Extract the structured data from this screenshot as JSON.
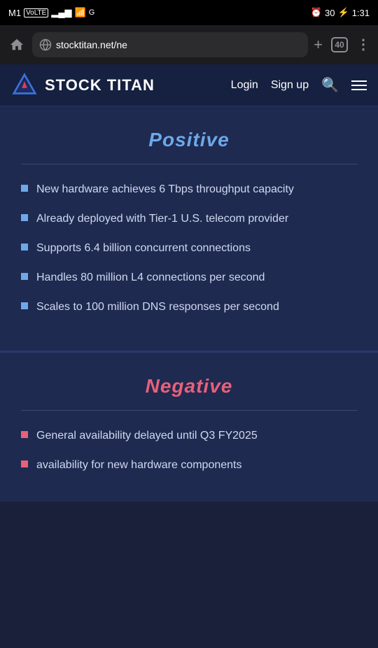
{
  "statusBar": {
    "carrier": "M1",
    "network": "VoLTE",
    "time": "1:31",
    "battery": "30",
    "tabsCount": "40"
  },
  "addressBar": {
    "url": "stocktitan.net/ne"
  },
  "navbar": {
    "title": "STOCK TITAN",
    "loginLabel": "Login",
    "signupLabel": "Sign up"
  },
  "positive": {
    "title": "Positive",
    "items": [
      "New hardware achieves 6 Tbps throughput capacity",
      "Already deployed with Tier-1 U.S. telecom provider",
      "Supports 6.4 billion concurrent connections",
      "Handles 80 million L4 connections per second",
      "Scales to 100 million DNS responses per second"
    ]
  },
  "negative": {
    "title": "Negative",
    "items": [
      "General availability delayed until Q3 FY2025",
      "availability for new hardware components"
    ]
  }
}
